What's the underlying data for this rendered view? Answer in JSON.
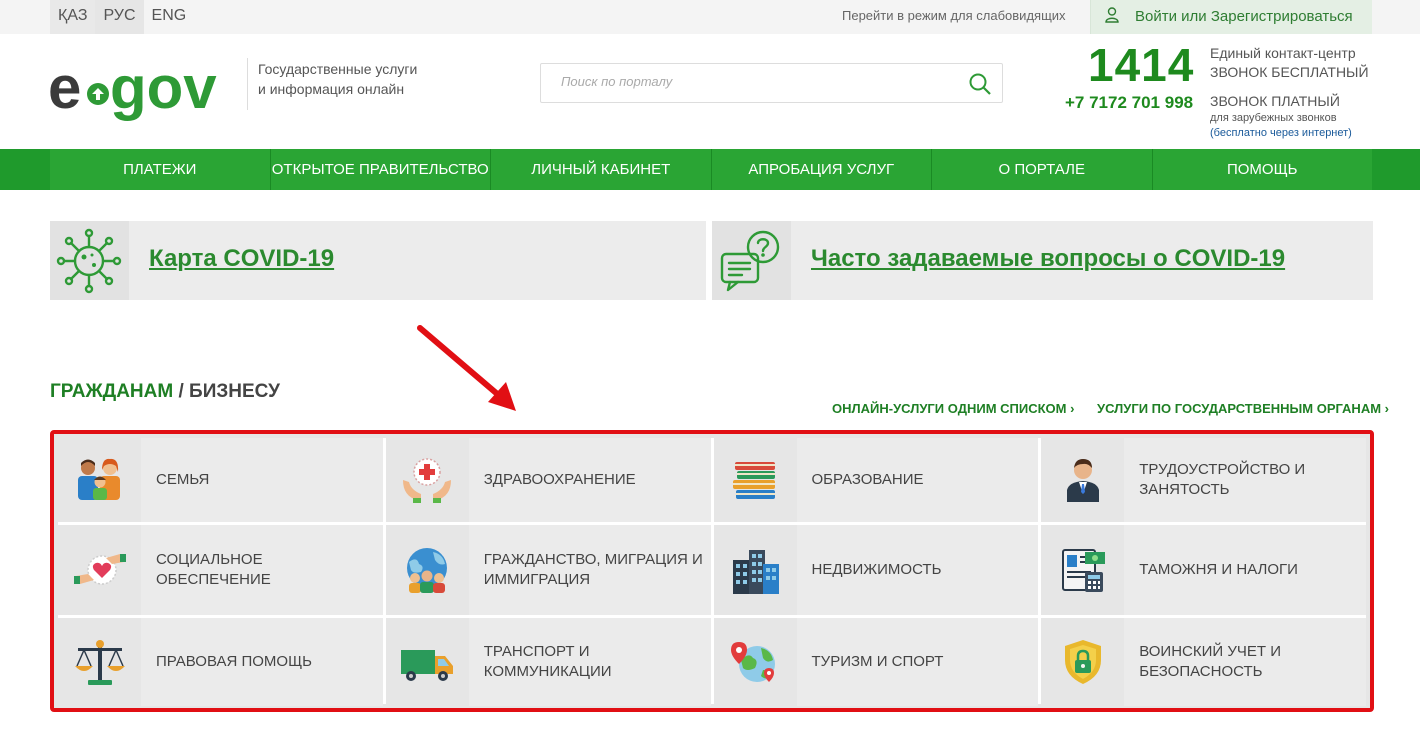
{
  "topbar": {
    "languages": [
      "ҚАЗ",
      "РУС",
      "ENG"
    ],
    "accessibility_link": "Перейти в режим для слабовидящих",
    "login_text": "Войти или Зарегистрироваться"
  },
  "header": {
    "tagline_line1": "Государственные услуги",
    "tagline_line2": "и информация онлайн",
    "search_placeholder": "Поиск по порталу",
    "contact_number": "1414",
    "contact_center": "Единый контакт-центр",
    "free_call": "ЗВОНОК БЕСПЛАТНЫЙ",
    "phone": "+7 7172 701 998",
    "paid_call": "ЗВОНОК ПЛАТНЫЙ",
    "foreign_calls": "для зарубежных звонков",
    "free_internet": "(бесплатно через интернет)"
  },
  "nav": {
    "items": [
      "ПЛАТЕЖИ",
      "ОТКРЫТОЕ ПРАВИТЕЛЬСТВО",
      "ЛИЧНЫЙ КАБИНЕТ",
      "АПРОБАЦИЯ УСЛУГ",
      "О ПОРТАЛЕ",
      "ПОМОЩЬ"
    ]
  },
  "banners": {
    "covid_map": "Карта COVID-19",
    "covid_faq": "Часто задаваемые вопросы о COVID-19"
  },
  "section": {
    "title_citizens": "ГРАЖДАНАМ",
    "title_sep": " / ",
    "title_business": "БИЗНЕСУ",
    "link_online_list": "ОНЛАЙН-УСЛУГИ ОДНИМ СПИСКОМ ›",
    "link_by_agency": "УСЛУГИ ПО ГОСУДАРСТВЕННЫМ ОРГАНАМ ›"
  },
  "categories": [
    {
      "label_1": "СЕМЬЯ",
      "label_2": "",
      "icon": "family-icon"
    },
    {
      "label_1": "ЗДРАВООХРАНЕНИЕ",
      "label_2": "",
      "icon": "healthcare-icon"
    },
    {
      "label_1": "ОБРАЗОВАНИЕ",
      "label_2": "",
      "icon": "books-icon"
    },
    {
      "label_1": "ТРУДОУСТРОЙСТВО И",
      "label_2": "ЗАНЯТОСТЬ",
      "icon": "worker-icon"
    },
    {
      "label_1": "СОЦИАЛЬНОЕ",
      "label_2": "ОБЕСПЕЧЕНИЕ",
      "icon": "heart-hands-icon"
    },
    {
      "label_1": "ГРАЖДАНСТВО, МИГРАЦИЯ И",
      "label_2": "ИММИГРАЦИЯ",
      "icon": "globe-people-icon"
    },
    {
      "label_1": "НЕДВИЖИМОСТЬ",
      "label_2": "",
      "icon": "buildings-icon"
    },
    {
      "label_1": "ТАМОЖНЯ И НАЛОГИ",
      "label_2": "",
      "icon": "tax-document-icon"
    },
    {
      "label_1": "ПРАВОВАЯ ПОМОЩЬ",
      "label_2": "",
      "icon": "scales-icon"
    },
    {
      "label_1": "ТРАНСПОРТ И",
      "label_2": "КОММУНИКАЦИИ",
      "icon": "truck-icon"
    },
    {
      "label_1": "ТУРИЗМ И СПОРТ",
      "label_2": "",
      "icon": "globe-pins-icon"
    },
    {
      "label_1": "ВОИНСКИЙ УЧЕТ И",
      "label_2": "БЕЗОПАСНОСТЬ",
      "icon": "shield-lock-icon"
    }
  ],
  "colors": {
    "brand_green": "#2aa534",
    "text_green": "#1e7f24",
    "highlight_red": "#e10f14"
  }
}
